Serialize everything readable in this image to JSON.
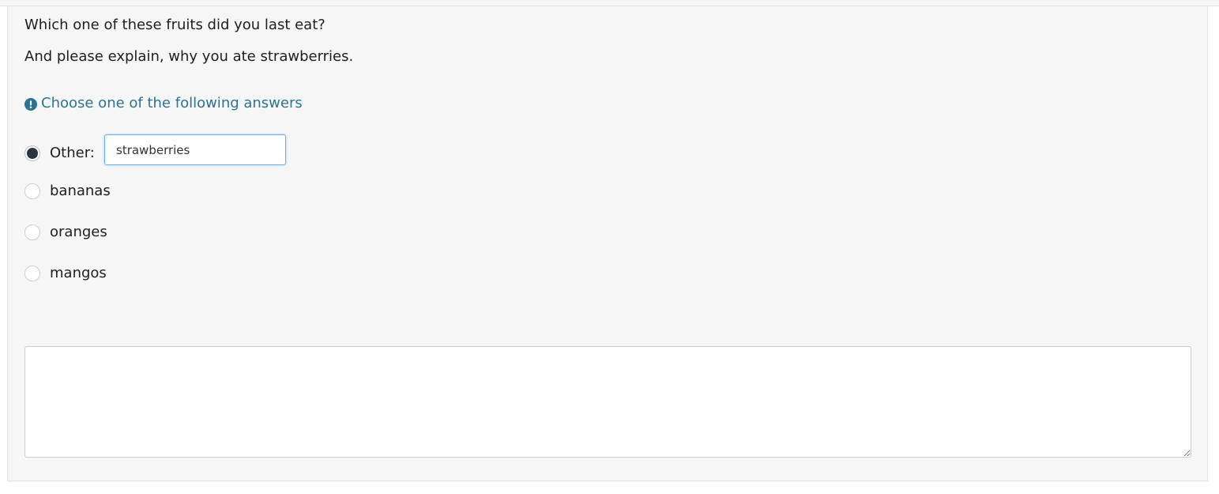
{
  "question": {
    "line1": "Which one of these fruits did you last eat?",
    "line2": "And please explain, why you ate strawberries."
  },
  "hint": {
    "text": "Choose one of the following answers",
    "icon": "exclamation-circle-icon",
    "color": "#2c7492"
  },
  "options": {
    "other": {
      "label": "Other:",
      "value": "strawberries",
      "checked": true
    },
    "items": [
      {
        "label": "bananas",
        "checked": false
      },
      {
        "label": "oranges",
        "checked": false
      },
      {
        "label": "mangos",
        "checked": false
      }
    ]
  },
  "explanation": {
    "value": ""
  },
  "colors": {
    "panel_background": "#f6f6f6",
    "radio_checked": "#2a3445",
    "input_focus_border": "#66afe9"
  }
}
